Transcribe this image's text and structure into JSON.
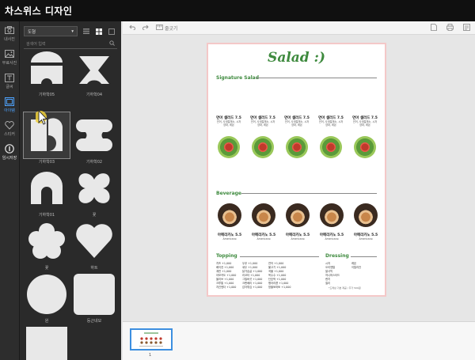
{
  "app": {
    "title": "차스위스 디자인"
  },
  "rail": {
    "items": [
      {
        "label": "내사진"
      },
      {
        "label": "무료사진"
      },
      {
        "label": "글씨"
      },
      {
        "label": "아이템"
      },
      {
        "label": "스티커"
      },
      {
        "label": "임시저장"
      }
    ]
  },
  "panel": {
    "category": "도형",
    "search_placeholder": "검색어 입력",
    "shapes": [
      {
        "label": "기하학05"
      },
      {
        "label": "기하학04"
      },
      {
        "label": "기하학03"
      },
      {
        "label": "기하학02"
      },
      {
        "label": "기하학01"
      },
      {
        "label": "꽃"
      },
      {
        "label": "꽃"
      },
      {
        "label": "하트"
      },
      {
        "label": "원"
      },
      {
        "label": "둥근네모"
      },
      {
        "label": "네모"
      }
    ]
  },
  "toolbar": {
    "align_label": "줄긋기"
  },
  "menu": {
    "title": "Salad :)",
    "signature": {
      "title": "Signature Salad",
      "items": [
        {
          "name": "연어 샐러드 7.5",
          "desc1": "연어, 사계절채소, 시저",
          "desc2": "양파, 레몬"
        },
        {
          "name": "연어 샐러드 7.5",
          "desc1": "연어, 사계절채소, 시저",
          "desc2": "양파, 레몬"
        },
        {
          "name": "연어 샐러드 7.5",
          "desc1": "연어, 사계절채소, 시저",
          "desc2": "양파, 레몬"
        },
        {
          "name": "연어 샐러드 7.5",
          "desc1": "연어, 사계절채소, 시저",
          "desc2": "양파, 레몬"
        },
        {
          "name": "연어 샐러드 7.5",
          "desc1": "연어, 사계절채소, 시저",
          "desc2": "양파, 레몬"
        }
      ]
    },
    "beverage": {
      "title": "Beverage",
      "items": [
        {
          "name": "아메리카노 5.5",
          "desc": "Americano"
        },
        {
          "name": "아메리카노 5.5",
          "desc": "Americano"
        },
        {
          "name": "아메리카노 5.5",
          "desc": "Americano"
        },
        {
          "name": "아메리카노 5.5",
          "desc": "Americano"
        },
        {
          "name": "아메리카노 5.5",
          "desc": "Americano"
        }
      ]
    },
    "topping": {
      "title": "Topping",
      "col1": [
        "치즈 +1,000",
        "베이컨 +1,000",
        "계란 +1,000",
        "아보카도 +1,000",
        "올리브 +1,000",
        "크루통 +1,000",
        "치킨텐더 +1,000"
      ],
      "col2": [
        "두부 +1,000",
        "새우 +1,000",
        "닭가슴살 +1,000",
        "리코타 +1,000",
        "그릴버섯 +1,000",
        "크랜베리 +1,000",
        "감자튀김 +1,000"
      ],
      "col3": [
        "연어 +1,000",
        "불고기 +1,000",
        "곡물 +1,000",
        "옥수수 +1,000",
        "단호박 +1,000",
        "병아리콩 +1,000",
        "방울토마토 +1,000"
      ]
    },
    "dressing": {
      "title": "Dressing",
      "col1": [
        "시저",
        "오리엔탈",
        "발사믹",
        "허니머스타드",
        "렌치",
        "칠리"
      ],
      "col2": [
        "레몬",
        "이탈리안"
      ],
      "note": "*드레싱 기본 제공 / 추가 500원"
    }
  },
  "pages": {
    "current": "1"
  }
}
